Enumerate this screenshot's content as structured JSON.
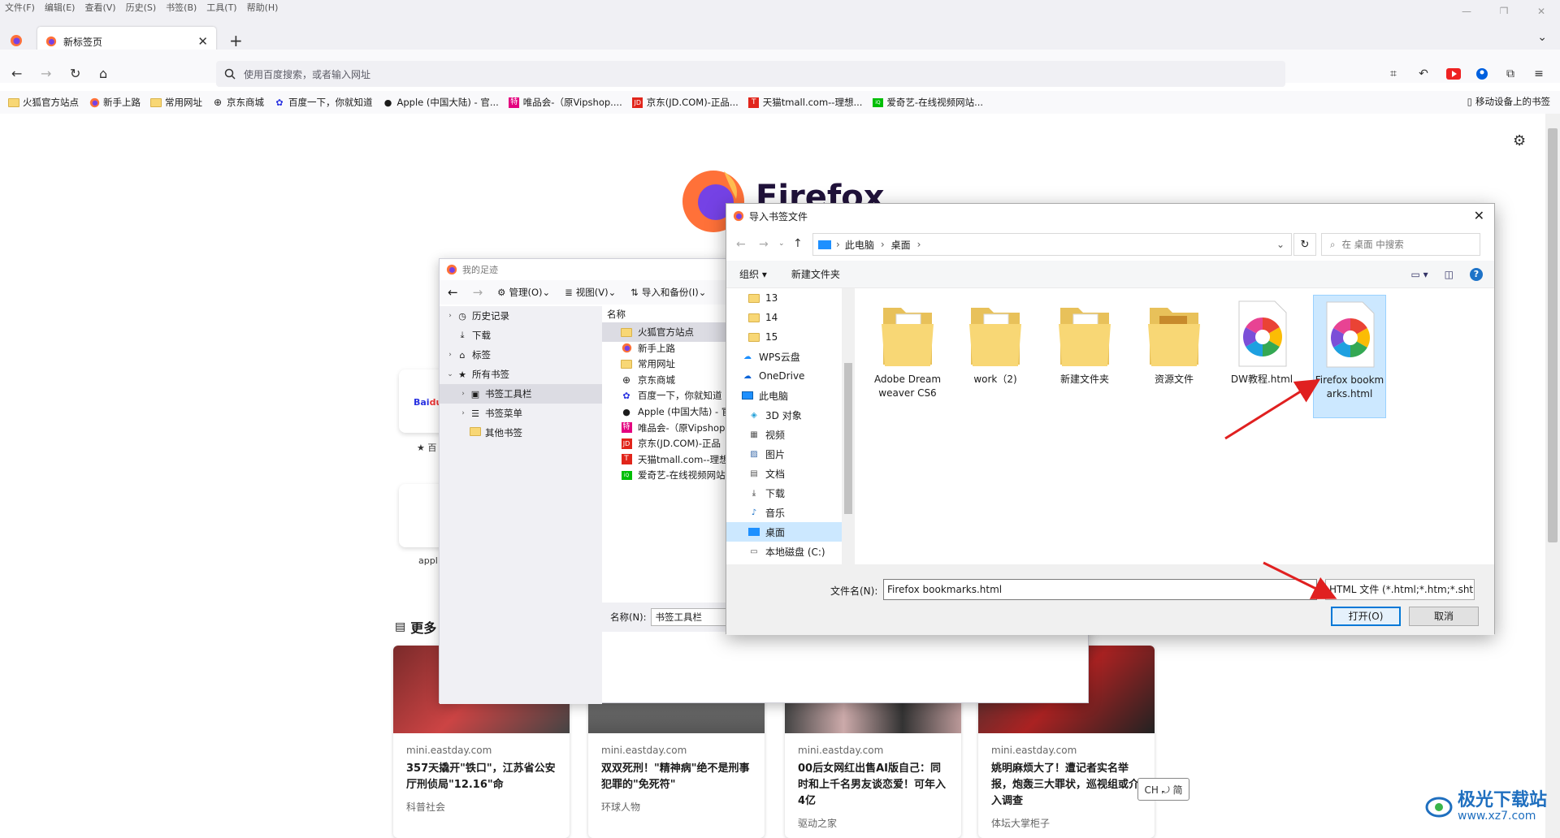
{
  "menu": [
    "文件(F)",
    "编辑(E)",
    "查看(V)",
    "历史(S)",
    "书签(B)",
    "工具(T)",
    "帮助(H)"
  ],
  "tab": {
    "title": "新标签页"
  },
  "urlbar": {
    "placeholder": "使用百度搜索，或者输入网址"
  },
  "bookmarks": [
    {
      "icon": "folder-icon",
      "label": "火狐官方站点"
    },
    {
      "icon": "firefox-icon",
      "label": "新手上路"
    },
    {
      "icon": "folder-icon",
      "label": "常用网址"
    },
    {
      "icon": "globe-icon",
      "label": "京东商城"
    },
    {
      "icon": "baidu-paw-icon",
      "label": "百度一下，你就知道"
    },
    {
      "icon": "apple-icon",
      "label": "Apple (中国大陆) - 官..."
    },
    {
      "icon": "vip-icon",
      "label": "唯品会-（原Vipshop...."
    },
    {
      "icon": "jd-icon",
      "label": "京东(JD.COM)-正品..."
    },
    {
      "icon": "tmall-icon",
      "label": "天猫tmall.com--理想..."
    },
    {
      "icon": "iqiyi-icon",
      "label": "爱奇艺-在线视频网站..."
    }
  ],
  "bookmarks_mobile": "移动设备上的书签",
  "ntp": {
    "wordmark": "Firefox",
    "shortcut_labels": [
      "百",
      "appl"
    ],
    "more_heading": "更多",
    "cards": [
      {
        "source": "mini.eastday.com",
        "headline": "357天撬开\"铁口\"，江苏省公安厅刑侦局\"12.16\"命",
        "publisher": "科普社会"
      },
      {
        "source": "mini.eastday.com",
        "headline": "双双死刑！\"精神病\"绝不是刑事犯罪的\"免死符\"",
        "publisher": "环球人物"
      },
      {
        "source": "mini.eastday.com",
        "headline": "00后女网红出售AI版自己：同时和上千名男友谈恋爱！可年入4亿",
        "publisher": "驱动之家"
      },
      {
        "source": "mini.eastday.com",
        "headline": "姚明麻烦大了！遭记者实名举报，炮轰三大罪状，巡视组或介入调查",
        "publisher": "体坛大掌柜子"
      }
    ]
  },
  "library": {
    "title": "我的足迹",
    "toolbar": {
      "manage": "管理(O)",
      "views": "视图(V)",
      "import": "导入和备份(I)"
    },
    "tree": [
      {
        "label": "历史记录",
        "chev": "›",
        "indent": 0,
        "icon": "clock-icon"
      },
      {
        "label": "下载",
        "chev": "",
        "indent": 0,
        "icon": "download-icon"
      },
      {
        "label": "标签",
        "chev": "›",
        "indent": 0,
        "icon": "tag-icon"
      },
      {
        "label": "所有书签",
        "chev": "⌄",
        "indent": 0,
        "icon": "star-icon"
      },
      {
        "label": "书签工具栏",
        "chev": "›",
        "indent": 1,
        "icon": "toolbar-icon",
        "selected": true
      },
      {
        "label": "书签菜单",
        "chev": "›",
        "indent": 1,
        "icon": "menu-icon"
      },
      {
        "label": "其他书签",
        "chev": "",
        "indent": 1,
        "icon": "folder-icon"
      }
    ],
    "column_name": "名称",
    "rows": [
      {
        "label": "火狐官方站点",
        "icon": "folder-icon",
        "selected": true
      },
      {
        "label": "新手上路",
        "icon": "firefox-icon"
      },
      {
        "label": "常用网址",
        "icon": "folder-icon"
      },
      {
        "label": "京东商城",
        "icon": "globe-icon"
      },
      {
        "label": "百度一下，你就知道",
        "icon": "baidu-paw-icon"
      },
      {
        "label": "Apple (中国大陆) - 官",
        "icon": "apple-icon"
      },
      {
        "label": "唯品会-（原Vipshop",
        "icon": "vip-icon"
      },
      {
        "label": "京东(JD.COM)-正品",
        "icon": "jd-icon"
      },
      {
        "label": "天猫tmall.com--理想",
        "icon": "tmall-icon"
      },
      {
        "label": "爱奇艺-在线视频网站",
        "icon": "iqiyi-icon"
      }
    ],
    "name_label": "名称(N):",
    "name_value": "书签工具栏"
  },
  "dialog": {
    "title": "导入书签文件",
    "breadcrumb": [
      "此电脑",
      "桌面"
    ],
    "search_placeholder": "在 桌面 中搜索",
    "organize": "组织 ▾",
    "new_folder": "新建文件夹",
    "tree": [
      {
        "label": "13",
        "icon": "folder-icon"
      },
      {
        "label": "14",
        "icon": "folder-icon"
      },
      {
        "label": "15",
        "icon": "folder-icon"
      },
      {
        "label": "WPS云盘",
        "icon": "cloud-icon"
      },
      {
        "label": "OneDrive",
        "icon": "onedrive-icon"
      },
      {
        "label": "此电脑",
        "icon": "pc-icon"
      },
      {
        "label": "3D 对象",
        "icon": "cube-icon"
      },
      {
        "label": "视频",
        "icon": "video-icon"
      },
      {
        "label": "图片",
        "icon": "picture-icon"
      },
      {
        "label": "文档",
        "icon": "document-icon"
      },
      {
        "label": "下载",
        "icon": "download-icon"
      },
      {
        "label": "音乐",
        "icon": "music-icon"
      },
      {
        "label": "桌面",
        "icon": "desktop-icon",
        "selected": true
      },
      {
        "label": "本地磁盘 (C:)",
        "icon": "disk-icon"
      }
    ],
    "files": [
      {
        "name": "Adobe Dreamweaver CS6",
        "type": "folder"
      },
      {
        "name": "work（2)",
        "type": "folder"
      },
      {
        "name": "新建文件夹",
        "type": "folder"
      },
      {
        "name": "资源文件",
        "type": "folder-image"
      },
      {
        "name": "DW教程.html",
        "type": "html"
      },
      {
        "name": "Firefox bookmarks.html",
        "type": "html",
        "selected": true
      }
    ],
    "filename_label": "文件名(N):",
    "filename_value": "Firefox  bookmarks.html",
    "filetype": "HTML 文件 (*.html;*.htm;*.sht",
    "open_button": "打开(O)",
    "cancel_button": "取消"
  },
  "ime": "CH ⤾ 简",
  "watermark": {
    "line1": "极光下载站",
    "line2": "www.xz7.com"
  },
  "colors": {
    "accent": "#0078d7",
    "arrow": "#e02020",
    "selection": "#cce8ff"
  }
}
